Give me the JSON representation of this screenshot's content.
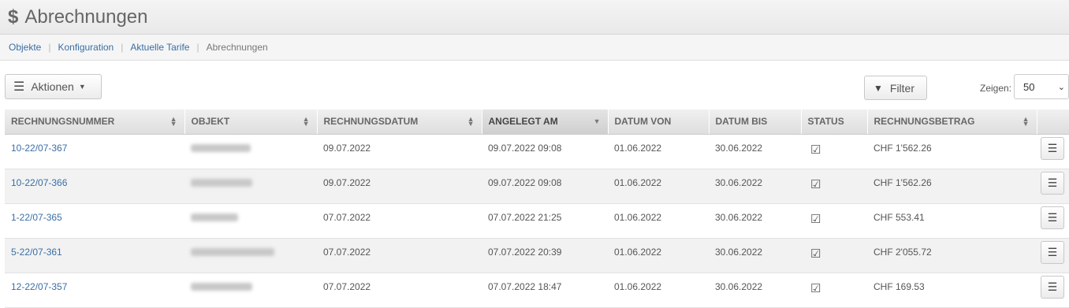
{
  "header": {
    "icon": "dollar-icon",
    "title": "Abrechnungen"
  },
  "breadcrumb": [
    {
      "label": "Objekte"
    },
    {
      "label": "Konfiguration"
    },
    {
      "label": "Aktuelle Tarife"
    },
    {
      "label": "Abrechnungen"
    }
  ],
  "toolbar": {
    "actions_label": "Aktionen",
    "filter_label": "Filter",
    "show_label": "Zeigen:",
    "page_size": "50"
  },
  "table": {
    "columns": [
      "RECHNUNGSNUMMER",
      "OBJEKT",
      "RECHNUNGSDATUM",
      "ANGELEGT AM",
      "DATUM VON",
      "DATUM BIS",
      "STATUS",
      "RECHNUNGSBETRAG"
    ],
    "sorted_column": "ANGELEGT AM",
    "rows": [
      {
        "number": "10-22/07-367",
        "date": "09.07.2022",
        "created": "09.07.2022 09:08",
        "from": "01.06.2022",
        "to": "30.06.2022",
        "status": "checked",
        "amount": "CHF 1'562.26"
      },
      {
        "number": "10-22/07-366",
        "date": "09.07.2022",
        "created": "09.07.2022 09:08",
        "from": "01.06.2022",
        "to": "30.06.2022",
        "status": "checked",
        "amount": "CHF 1'562.26"
      },
      {
        "number": "1-22/07-365",
        "date": "07.07.2022",
        "created": "07.07.2022 21:25",
        "from": "01.06.2022",
        "to": "30.06.2022",
        "status": "checked",
        "amount": "CHF 553.41"
      },
      {
        "number": "5-22/07-361",
        "date": "07.07.2022",
        "created": "07.07.2022 20:39",
        "from": "01.06.2022",
        "to": "30.06.2022",
        "status": "checked",
        "amount": "CHF 2'055.72"
      },
      {
        "number": "12-22/07-357",
        "date": "07.07.2022",
        "created": "07.07.2022 18:47",
        "from": "01.06.2022",
        "to": "30.06.2022",
        "status": "checked",
        "amount": "CHF 169.53"
      }
    ]
  }
}
